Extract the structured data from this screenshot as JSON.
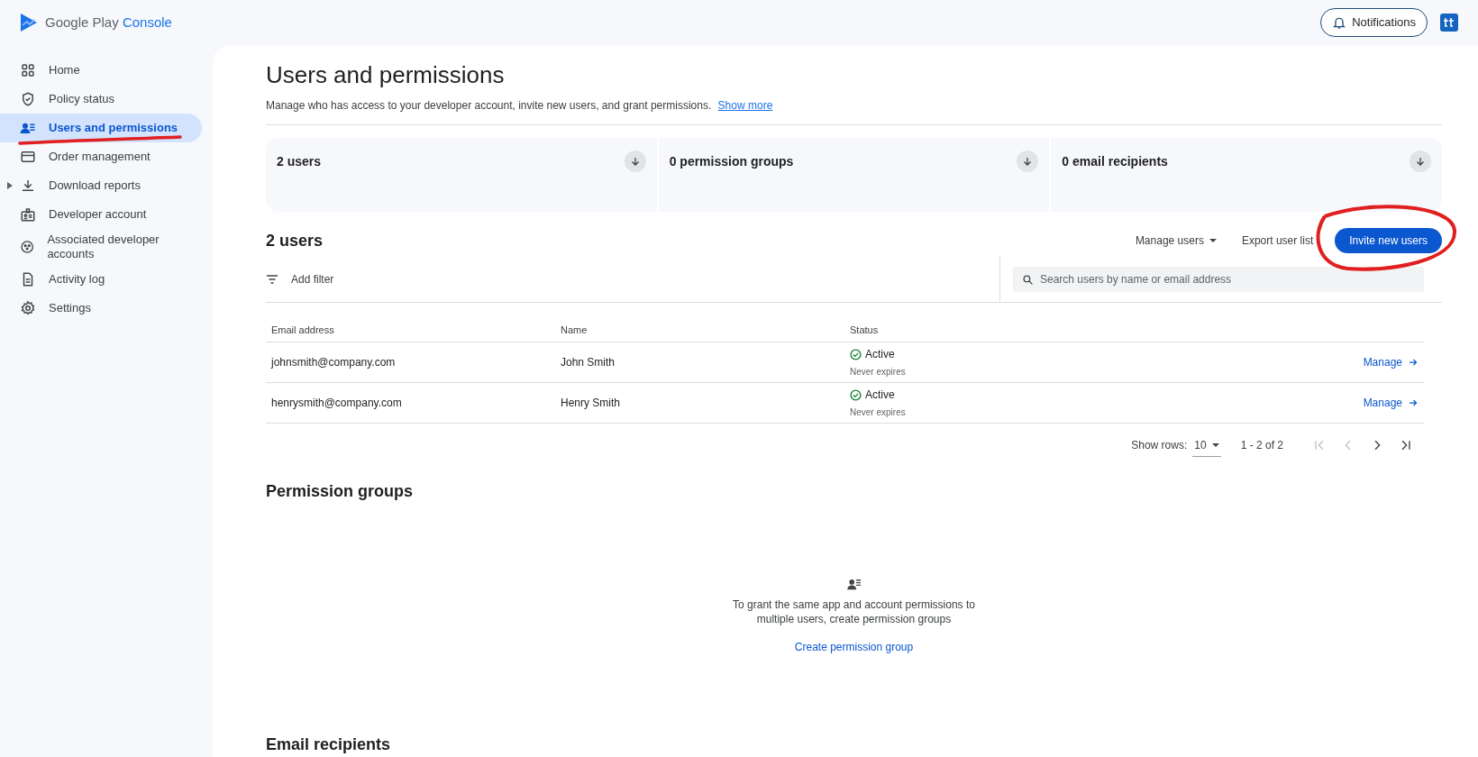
{
  "header": {
    "logo_brand": "Google Play",
    "logo_product": "Console",
    "notifications_button": "Notifications"
  },
  "sidebar": {
    "items": [
      {
        "label": "Home",
        "selected": false,
        "expandable": false
      },
      {
        "label": "Policy status",
        "selected": false,
        "expandable": false
      },
      {
        "label": "Users and permissions",
        "selected": true,
        "expandable": false
      },
      {
        "label": "Order management",
        "selected": false,
        "expandable": false
      },
      {
        "label": "Download reports",
        "selected": false,
        "expandable": true
      },
      {
        "label": "Developer account",
        "selected": false,
        "expandable": false
      },
      {
        "label": "Associated developer accounts",
        "selected": false,
        "expandable": false
      },
      {
        "label": "Activity log",
        "selected": false,
        "expandable": false
      },
      {
        "label": "Settings",
        "selected": false,
        "expandable": false
      }
    ]
  },
  "page": {
    "title": "Users and permissions",
    "description": "Manage who has access to your developer account, invite new users, and grant permissions.",
    "show_more": "Show more"
  },
  "summary_cards": [
    {
      "label": "2 users"
    },
    {
      "label": "0 permission groups"
    },
    {
      "label": "0 email recipients"
    }
  ],
  "users_section": {
    "title": "2 users",
    "manage_users": "Manage users",
    "export": "Export user list",
    "invite": "Invite new users",
    "add_filter": "Add filter",
    "search": {
      "placeholder": "Search users by name or email address"
    },
    "table": {
      "columns": [
        "Email address",
        "Name",
        "Status"
      ],
      "rows": [
        {
          "email": "johnsmith@company.com",
          "name": "John Smith",
          "status": "Active",
          "expiry": "Never expires",
          "action": "Manage"
        },
        {
          "email": "henrysmith@company.com",
          "name": "Henry Smith",
          "status": "Active",
          "expiry": "Never expires",
          "action": "Manage"
        }
      ]
    },
    "pagination": {
      "label": "Show rows:",
      "rows_per_page": "10",
      "range": "1 - 2 of 2"
    }
  },
  "permission_groups": {
    "title": "Permission groups",
    "empty_text": "To grant the same app and account permissions to multiple users, create permission groups",
    "create_link": "Create permission group"
  },
  "email_recipients": {
    "title": "Email recipients"
  }
}
